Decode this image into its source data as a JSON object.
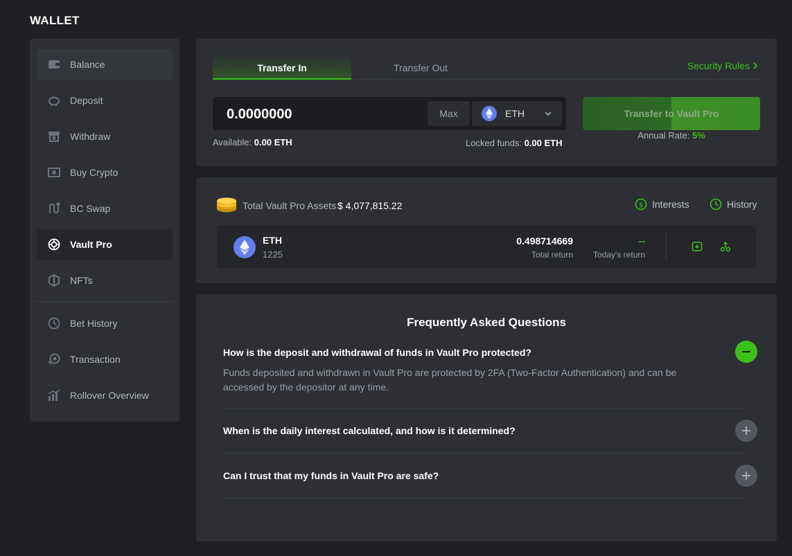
{
  "page": {
    "title": "WALLET"
  },
  "sidebar": {
    "items": [
      {
        "label": "Balance",
        "icon": "wallet-icon"
      },
      {
        "label": "Deposit",
        "icon": "piggy-bank-icon"
      },
      {
        "label": "Withdraw",
        "icon": "atm-icon"
      },
      {
        "label": "Buy Crypto",
        "icon": "cash-icon"
      },
      {
        "label": "BC Swap",
        "icon": "swap-icon"
      },
      {
        "label": "Vault Pro",
        "icon": "vault-icon"
      },
      {
        "label": "NFTs",
        "icon": "nft-icon"
      },
      {
        "label": "Bet History",
        "icon": "clock-icon"
      },
      {
        "label": "Transaction",
        "icon": "coin-transaction-icon"
      },
      {
        "label": "Rollover Overview",
        "icon": "bar-chart-icon"
      }
    ]
  },
  "transfer": {
    "tabs": [
      "Transfer In",
      "Transfer Out"
    ],
    "active_tab": "Transfer In",
    "security_rules": "Security Rules",
    "amount": "0.0000000",
    "max_label": "Max",
    "coin": "ETH",
    "available_label": "Available:",
    "available_value": "0.00 ETH",
    "locked_label": "Locked funds:",
    "locked_value": "0.00 ETH",
    "button_label": "Transfer to Vault Pro",
    "annual_label": "Annual Rate:",
    "annual_value": "5%"
  },
  "assets": {
    "label": "Total Vault Pro Assets",
    "value": "$ 4,077,815.22",
    "interests_label": "Interests",
    "history_label": "History",
    "row": {
      "coin": "ETH",
      "sub": "1225",
      "total_return": "0.498714669",
      "total_return_label": "Total return",
      "today_return": "--",
      "today_return_label": "Today's return"
    }
  },
  "faq": {
    "title": "Frequently Asked Questions",
    "items": [
      {
        "question": "How is the deposit and withdrawal of funds in Vault Pro protected?",
        "answer": "Funds deposited and withdrawn in Vault Pro are protected by 2FA (Two-Factor Authentication) and can be accessed by the depositor at any time.",
        "expanded": true
      },
      {
        "question": "When is the daily interest calculated, and how is it determined?",
        "expanded": false
      },
      {
        "question": "Can I trust that my funds in Vault Pro are safe?",
        "expanded": false
      }
    ]
  },
  "colors": {
    "accent": "#3bc117",
    "bg": "#1f2023",
    "card": "#2d2f34"
  }
}
